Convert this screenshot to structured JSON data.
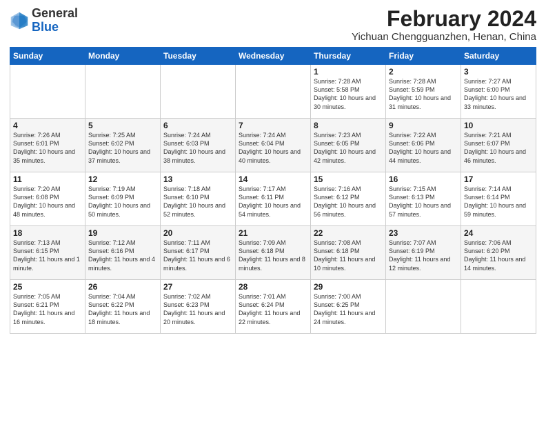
{
  "logo": {
    "general": "General",
    "blue": "Blue"
  },
  "title": {
    "month_year": "February 2024",
    "location": "Yichuan Chengguanzhen, Henan, China"
  },
  "days_of_week": [
    "Sunday",
    "Monday",
    "Tuesday",
    "Wednesday",
    "Thursday",
    "Friday",
    "Saturday"
  ],
  "weeks": [
    [
      {
        "day": "",
        "sunrise": "",
        "sunset": "",
        "daylight": ""
      },
      {
        "day": "",
        "sunrise": "",
        "sunset": "",
        "daylight": ""
      },
      {
        "day": "",
        "sunrise": "",
        "sunset": "",
        "daylight": ""
      },
      {
        "day": "",
        "sunrise": "",
        "sunset": "",
        "daylight": ""
      },
      {
        "day": "1",
        "sunrise": "Sunrise: 7:28 AM",
        "sunset": "Sunset: 5:58 PM",
        "daylight": "Daylight: 10 hours and 30 minutes."
      },
      {
        "day": "2",
        "sunrise": "Sunrise: 7:28 AM",
        "sunset": "Sunset: 5:59 PM",
        "daylight": "Daylight: 10 hours and 31 minutes."
      },
      {
        "day": "3",
        "sunrise": "Sunrise: 7:27 AM",
        "sunset": "Sunset: 6:00 PM",
        "daylight": "Daylight: 10 hours and 33 minutes."
      }
    ],
    [
      {
        "day": "4",
        "sunrise": "Sunrise: 7:26 AM",
        "sunset": "Sunset: 6:01 PM",
        "daylight": "Daylight: 10 hours and 35 minutes."
      },
      {
        "day": "5",
        "sunrise": "Sunrise: 7:25 AM",
        "sunset": "Sunset: 6:02 PM",
        "daylight": "Daylight: 10 hours and 37 minutes."
      },
      {
        "day": "6",
        "sunrise": "Sunrise: 7:24 AM",
        "sunset": "Sunset: 6:03 PM",
        "daylight": "Daylight: 10 hours and 38 minutes."
      },
      {
        "day": "7",
        "sunrise": "Sunrise: 7:24 AM",
        "sunset": "Sunset: 6:04 PM",
        "daylight": "Daylight: 10 hours and 40 minutes."
      },
      {
        "day": "8",
        "sunrise": "Sunrise: 7:23 AM",
        "sunset": "Sunset: 6:05 PM",
        "daylight": "Daylight: 10 hours and 42 minutes."
      },
      {
        "day": "9",
        "sunrise": "Sunrise: 7:22 AM",
        "sunset": "Sunset: 6:06 PM",
        "daylight": "Daylight: 10 hours and 44 minutes."
      },
      {
        "day": "10",
        "sunrise": "Sunrise: 7:21 AM",
        "sunset": "Sunset: 6:07 PM",
        "daylight": "Daylight: 10 hours and 46 minutes."
      }
    ],
    [
      {
        "day": "11",
        "sunrise": "Sunrise: 7:20 AM",
        "sunset": "Sunset: 6:08 PM",
        "daylight": "Daylight: 10 hours and 48 minutes."
      },
      {
        "day": "12",
        "sunrise": "Sunrise: 7:19 AM",
        "sunset": "Sunset: 6:09 PM",
        "daylight": "Daylight: 10 hours and 50 minutes."
      },
      {
        "day": "13",
        "sunrise": "Sunrise: 7:18 AM",
        "sunset": "Sunset: 6:10 PM",
        "daylight": "Daylight: 10 hours and 52 minutes."
      },
      {
        "day": "14",
        "sunrise": "Sunrise: 7:17 AM",
        "sunset": "Sunset: 6:11 PM",
        "daylight": "Daylight: 10 hours and 54 minutes."
      },
      {
        "day": "15",
        "sunrise": "Sunrise: 7:16 AM",
        "sunset": "Sunset: 6:12 PM",
        "daylight": "Daylight: 10 hours and 56 minutes."
      },
      {
        "day": "16",
        "sunrise": "Sunrise: 7:15 AM",
        "sunset": "Sunset: 6:13 PM",
        "daylight": "Daylight: 10 hours and 57 minutes."
      },
      {
        "day": "17",
        "sunrise": "Sunrise: 7:14 AM",
        "sunset": "Sunset: 6:14 PM",
        "daylight": "Daylight: 10 hours and 59 minutes."
      }
    ],
    [
      {
        "day": "18",
        "sunrise": "Sunrise: 7:13 AM",
        "sunset": "Sunset: 6:15 PM",
        "daylight": "Daylight: 11 hours and 1 minute."
      },
      {
        "day": "19",
        "sunrise": "Sunrise: 7:12 AM",
        "sunset": "Sunset: 6:16 PM",
        "daylight": "Daylight: 11 hours and 4 minutes."
      },
      {
        "day": "20",
        "sunrise": "Sunrise: 7:11 AM",
        "sunset": "Sunset: 6:17 PM",
        "daylight": "Daylight: 11 hours and 6 minutes."
      },
      {
        "day": "21",
        "sunrise": "Sunrise: 7:09 AM",
        "sunset": "Sunset: 6:18 PM",
        "daylight": "Daylight: 11 hours and 8 minutes."
      },
      {
        "day": "22",
        "sunrise": "Sunrise: 7:08 AM",
        "sunset": "Sunset: 6:18 PM",
        "daylight": "Daylight: 11 hours and 10 minutes."
      },
      {
        "day": "23",
        "sunrise": "Sunrise: 7:07 AM",
        "sunset": "Sunset: 6:19 PM",
        "daylight": "Daylight: 11 hours and 12 minutes."
      },
      {
        "day": "24",
        "sunrise": "Sunrise: 7:06 AM",
        "sunset": "Sunset: 6:20 PM",
        "daylight": "Daylight: 11 hours and 14 minutes."
      }
    ],
    [
      {
        "day": "25",
        "sunrise": "Sunrise: 7:05 AM",
        "sunset": "Sunset: 6:21 PM",
        "daylight": "Daylight: 11 hours and 16 minutes."
      },
      {
        "day": "26",
        "sunrise": "Sunrise: 7:04 AM",
        "sunset": "Sunset: 6:22 PM",
        "daylight": "Daylight: 11 hours and 18 minutes."
      },
      {
        "day": "27",
        "sunrise": "Sunrise: 7:02 AM",
        "sunset": "Sunset: 6:23 PM",
        "daylight": "Daylight: 11 hours and 20 minutes."
      },
      {
        "day": "28",
        "sunrise": "Sunrise: 7:01 AM",
        "sunset": "Sunset: 6:24 PM",
        "daylight": "Daylight: 11 hours and 22 minutes."
      },
      {
        "day": "29",
        "sunrise": "Sunrise: 7:00 AM",
        "sunset": "Sunset: 6:25 PM",
        "daylight": "Daylight: 11 hours and 24 minutes."
      },
      {
        "day": "",
        "sunrise": "",
        "sunset": "",
        "daylight": ""
      },
      {
        "day": "",
        "sunrise": "",
        "sunset": "",
        "daylight": ""
      }
    ]
  ]
}
